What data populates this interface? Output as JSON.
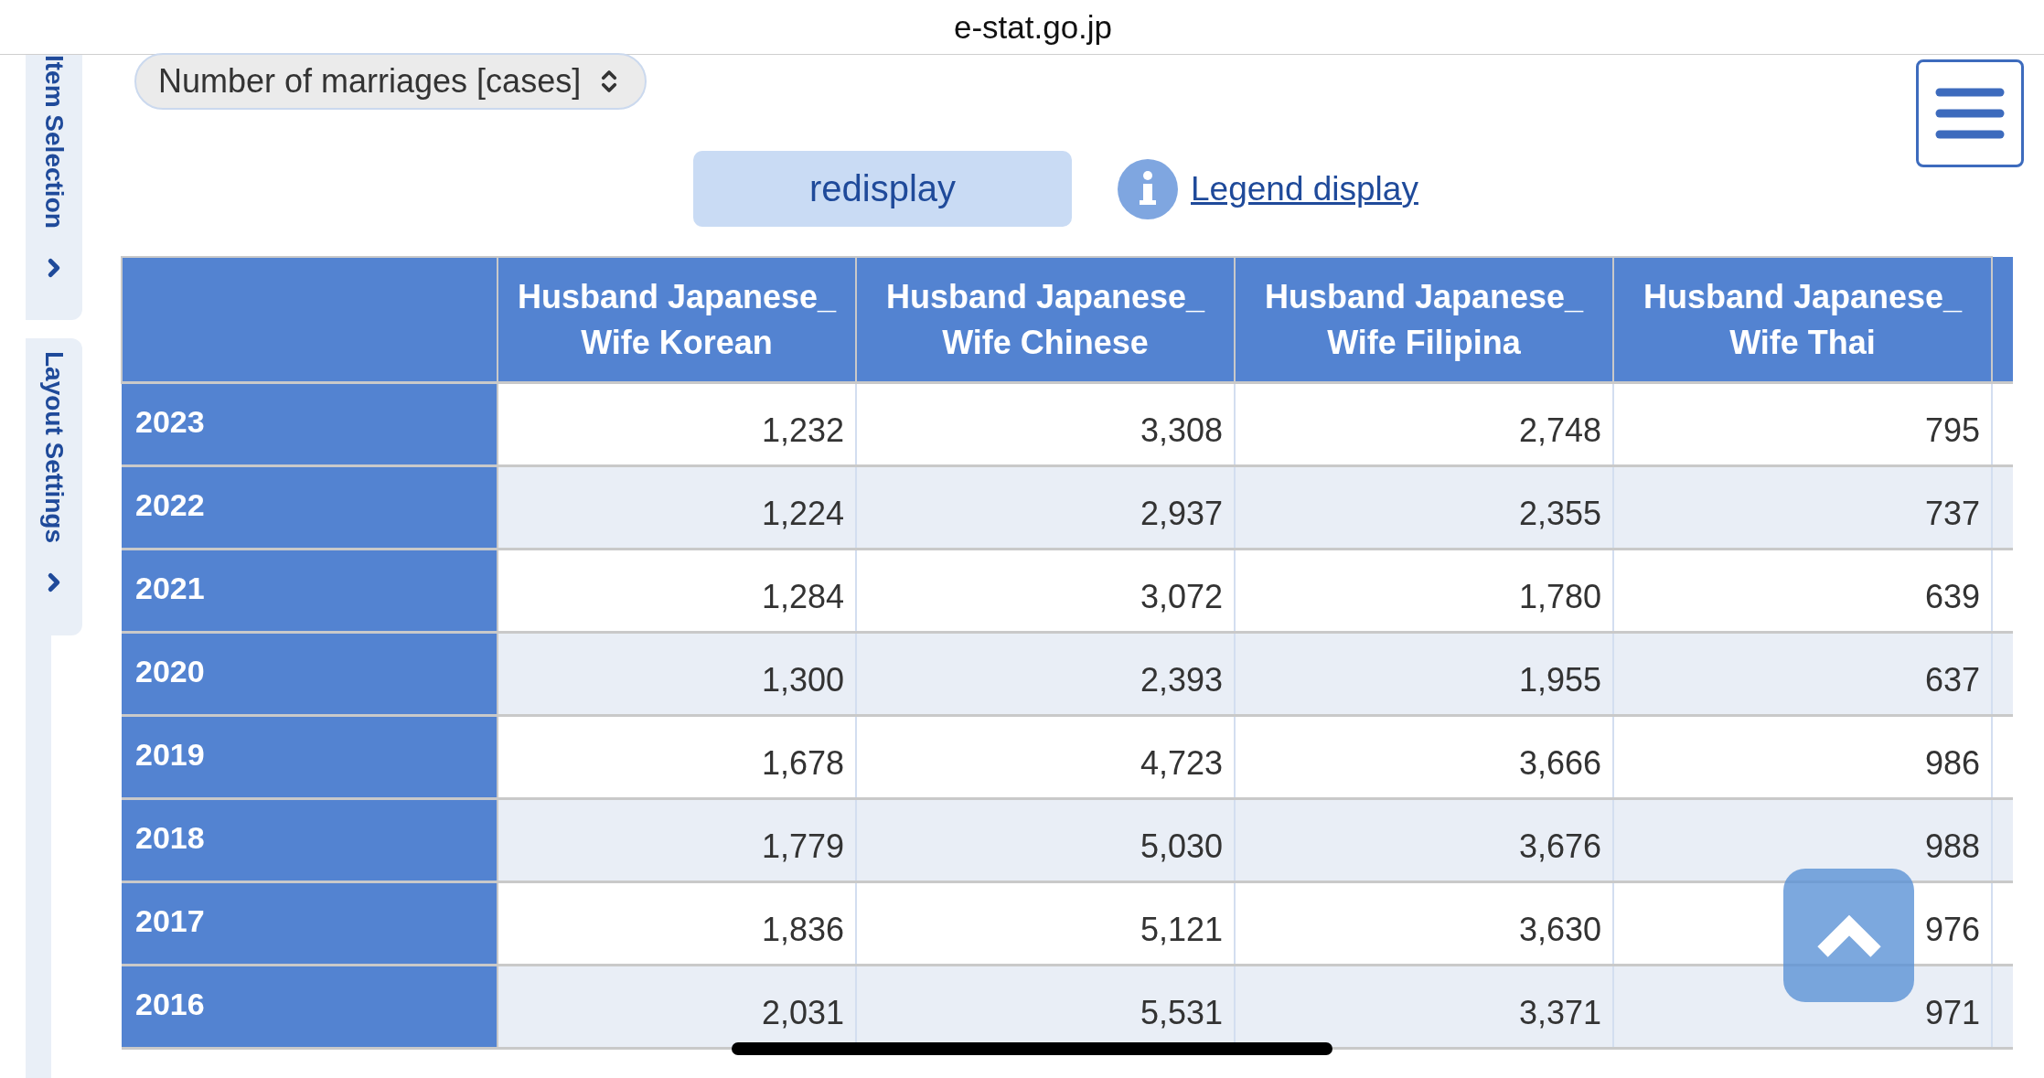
{
  "address_bar": {
    "url": "e-stat.go.jp"
  },
  "side_tabs": [
    {
      "label": "Item Selection"
    },
    {
      "label": "Layout Settings"
    }
  ],
  "item_select": {
    "value": "Number of marriages [cases]"
  },
  "redisplay_button": {
    "label": "redisplay"
  },
  "legend_link": {
    "label": "Legend display"
  },
  "table": {
    "columns": [
      "Husband Japanese_\nWife Korean",
      "Husband Japanese_\nWife Chinese",
      "Husband Japanese_\nWife Filipina",
      "Husband Japanese_\nWife Thai"
    ],
    "rows": [
      {
        "year": "2023",
        "values": [
          "1,232",
          "3,308",
          "2,748",
          "795"
        ]
      },
      {
        "year": "2022",
        "values": [
          "1,224",
          "2,937",
          "2,355",
          "737"
        ]
      },
      {
        "year": "2021",
        "values": [
          "1,284",
          "3,072",
          "1,780",
          "639"
        ]
      },
      {
        "year": "2020",
        "values": [
          "1,300",
          "2,393",
          "1,955",
          "637"
        ]
      },
      {
        "year": "2019",
        "values": [
          "1,678",
          "4,723",
          "3,666",
          "986"
        ]
      },
      {
        "year": "2018",
        "values": [
          "1,779",
          "5,030",
          "3,676",
          "988"
        ]
      },
      {
        "year": "2017",
        "values": [
          "1,836",
          "5,121",
          "3,630",
          "976"
        ]
      },
      {
        "year": "2016",
        "values": [
          "2,031",
          "5,531",
          "3,371",
          "971"
        ]
      }
    ]
  }
}
